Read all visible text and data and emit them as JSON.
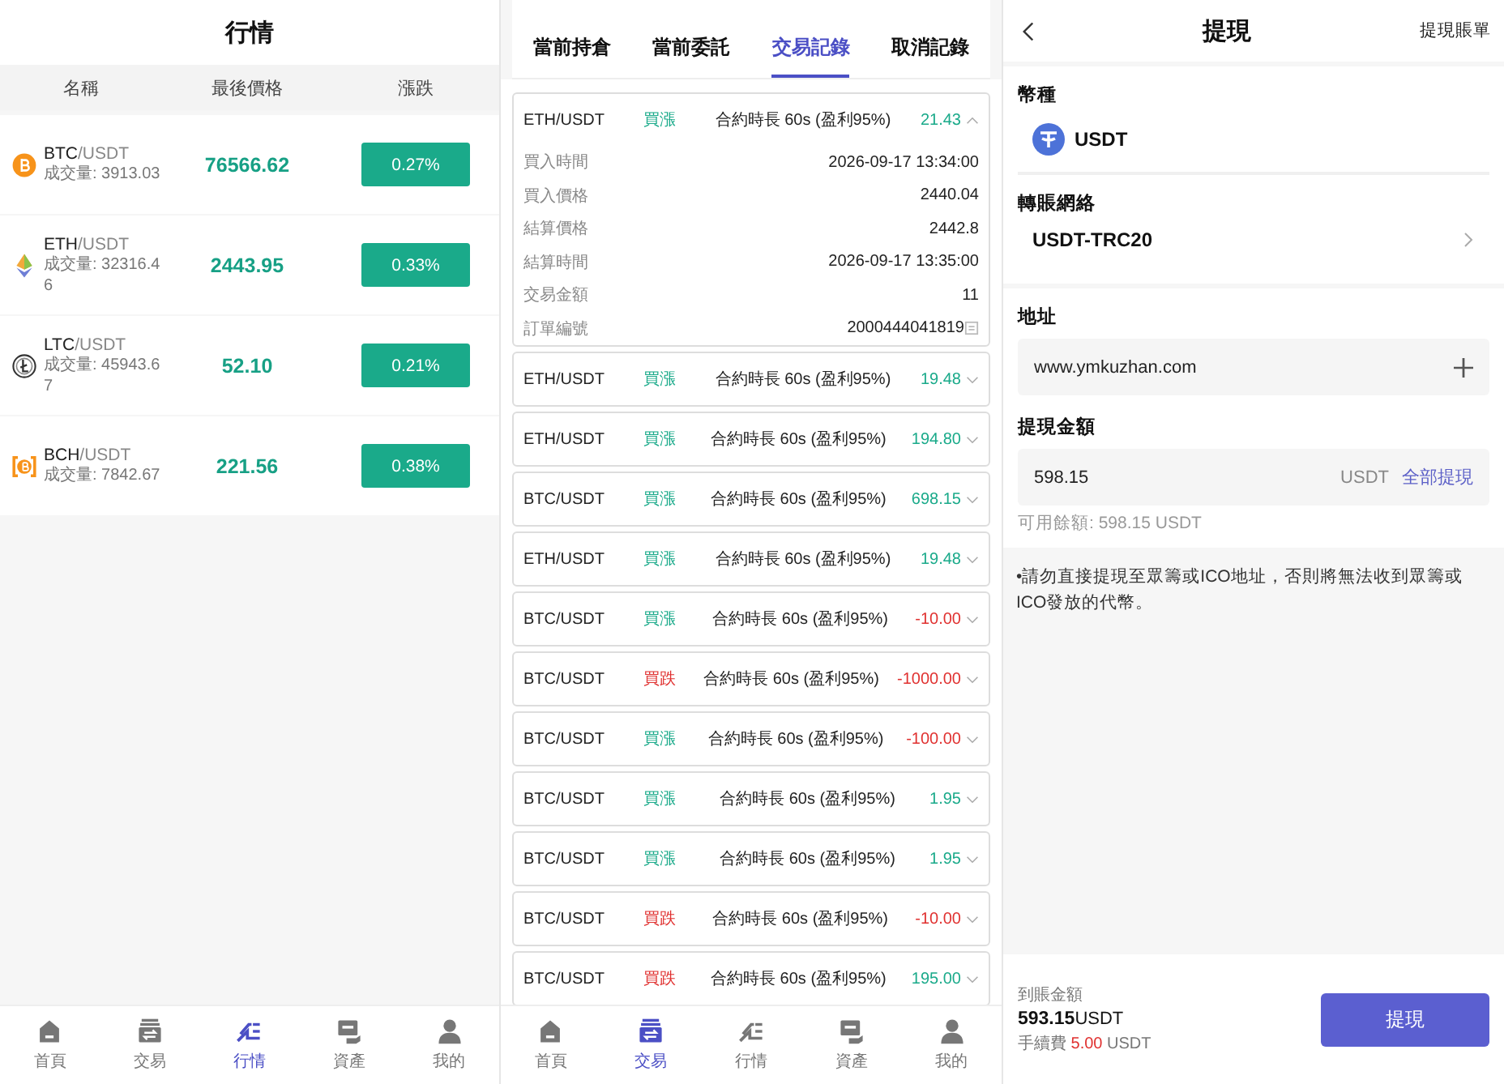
{
  "market": {
    "title": "行情",
    "columns": [
      "名稱",
      "最後價格",
      "漲跌"
    ],
    "rows": [
      {
        "kind": "btc",
        "base": "BTC",
        "quote": "/USDT",
        "volume": "成交量: 3913.03",
        "price": "76566.62",
        "change": "0.27%"
      },
      {
        "kind": "eth",
        "base": "ETH",
        "quote": "/USDT",
        "volume": "成交量: 32316.46",
        "price": "2443.95",
        "change": "0.33%"
      },
      {
        "kind": "ltc",
        "base": "LTC",
        "quote": "/USDT",
        "volume": "成交量: 45943.67",
        "price": "52.10",
        "change": "0.21%"
      },
      {
        "kind": "bch",
        "base": "BCH",
        "quote": "/USDT",
        "volume": "成交量: 7842.67",
        "price": "221.56",
        "change": "0.38%"
      }
    ],
    "nav": [
      {
        "kind": "home",
        "label": "首頁",
        "selected": false
      },
      {
        "kind": "trade",
        "label": "交易",
        "selected": false
      },
      {
        "kind": "market",
        "label": "行情",
        "selected": true
      },
      {
        "kind": "assets",
        "label": "資產",
        "selected": false
      },
      {
        "kind": "user",
        "label": "我的",
        "selected": false
      }
    ]
  },
  "trades": {
    "tabs": [
      {
        "label": "當前持倉",
        "selected": false
      },
      {
        "label": "當前委託",
        "selected": false
      },
      {
        "label": "交易記錄",
        "selected": true
      },
      {
        "label": "取消記錄",
        "selected": false
      }
    ],
    "records": [
      {
        "pair": "ETH/USDT",
        "side": {
          "label": "買漲",
          "kind": "up"
        },
        "contract": "合約時長 60s (盈利95%)",
        "amount": {
          "value": "21.43",
          "kind": "gain"
        },
        "expanded": true,
        "details": [
          {
            "label": "買入時間",
            "value": "2026-09-17 13:34:00"
          },
          {
            "label": "買入價格",
            "value": "2440.04"
          },
          {
            "label": "結算價格",
            "value": "2442.8"
          },
          {
            "label": "結算時間",
            "value": "2026-09-17 13:35:00"
          },
          {
            "label": "交易金額",
            "value": "11"
          },
          {
            "label": "訂單編號",
            "value": "2000444041819",
            "copy": true
          }
        ]
      },
      {
        "pair": "ETH/USDT",
        "side": {
          "label": "買漲",
          "kind": "up"
        },
        "contract": "合約時長 60s (盈利95%)",
        "amount": {
          "value": "19.48",
          "kind": "gain"
        },
        "expanded": false
      },
      {
        "pair": "ETH/USDT",
        "side": {
          "label": "買漲",
          "kind": "up"
        },
        "contract": "合約時長 60s (盈利95%)",
        "amount": {
          "value": "194.80",
          "kind": "gain"
        },
        "expanded": false
      },
      {
        "pair": "BTC/USDT",
        "side": {
          "label": "買漲",
          "kind": "up"
        },
        "contract": "合約時長 60s (盈利95%)",
        "amount": {
          "value": "698.15",
          "kind": "gain"
        },
        "expanded": false
      },
      {
        "pair": "ETH/USDT",
        "side": {
          "label": "買漲",
          "kind": "up"
        },
        "contract": "合約時長 60s (盈利95%)",
        "amount": {
          "value": "19.48",
          "kind": "gain"
        },
        "expanded": false
      },
      {
        "pair": "BTC/USDT",
        "side": {
          "label": "買漲",
          "kind": "up"
        },
        "contract": "合約時長 60s (盈利95%)",
        "amount": {
          "value": "-10.00",
          "kind": "loss"
        },
        "expanded": false
      },
      {
        "pair": "BTC/USDT",
        "side": {
          "label": "買跌",
          "kind": "down"
        },
        "contract": "合約時長 60s (盈利95%)",
        "amount": {
          "value": "-1000.00",
          "kind": "loss"
        },
        "expanded": false
      },
      {
        "pair": "BTC/USDT",
        "side": {
          "label": "買漲",
          "kind": "up"
        },
        "contract": "合約時長 60s (盈利95%)",
        "amount": {
          "value": "-100.00",
          "kind": "loss"
        },
        "expanded": false
      },
      {
        "pair": "BTC/USDT",
        "side": {
          "label": "買漲",
          "kind": "up"
        },
        "contract": "合約時長 60s (盈利95%)",
        "amount": {
          "value": "1.95",
          "kind": "gain"
        },
        "expanded": false
      },
      {
        "pair": "BTC/USDT",
        "side": {
          "label": "買漲",
          "kind": "up"
        },
        "contract": "合約時長 60s (盈利95%)",
        "amount": {
          "value": "1.95",
          "kind": "gain"
        },
        "expanded": false
      },
      {
        "pair": "BTC/USDT",
        "side": {
          "label": "買跌",
          "kind": "down"
        },
        "contract": "合約時長 60s (盈利95%)",
        "amount": {
          "value": "-10.00",
          "kind": "loss"
        },
        "expanded": false
      },
      {
        "pair": "BTC/USDT",
        "side": {
          "label": "買跌",
          "kind": "down"
        },
        "contract": "合約時長 60s (盈利95%)",
        "amount": {
          "value": "195.00",
          "kind": "gain"
        },
        "expanded": false
      }
    ],
    "nav": [
      {
        "kind": "home",
        "label": "首頁",
        "selected": false
      },
      {
        "kind": "trade",
        "label": "交易",
        "selected": true
      },
      {
        "kind": "market",
        "label": "行情",
        "selected": false
      },
      {
        "kind": "assets",
        "label": "資產",
        "selected": false
      },
      {
        "kind": "user",
        "label": "我的",
        "selected": false
      }
    ]
  },
  "withdraw": {
    "title": "提現",
    "history_link": "提現賬單",
    "currency_label": "幣種",
    "currency": "USDT",
    "network_label": "轉賬網絡",
    "network": "USDT-TRC20",
    "address_label": "地址",
    "address": "www.ymkuzhan.com",
    "amount_label": "提現金額",
    "amount": "598.15",
    "amount_unit": "USDT",
    "withdraw_all": "全部提現",
    "available": "可用餘額: 598.15 USDT",
    "notice": "•請勿直接提現至眾籌或ICO地址，否則將無法收到眾籌或ICO發放的代幣。",
    "received_label": "到賬金額",
    "received_amount": "593.15",
    "received_unit": "USDT",
    "fee_label": "手續費",
    "fee": "5.00",
    "fee_unit": "USDT",
    "submit": "提現"
  }
}
